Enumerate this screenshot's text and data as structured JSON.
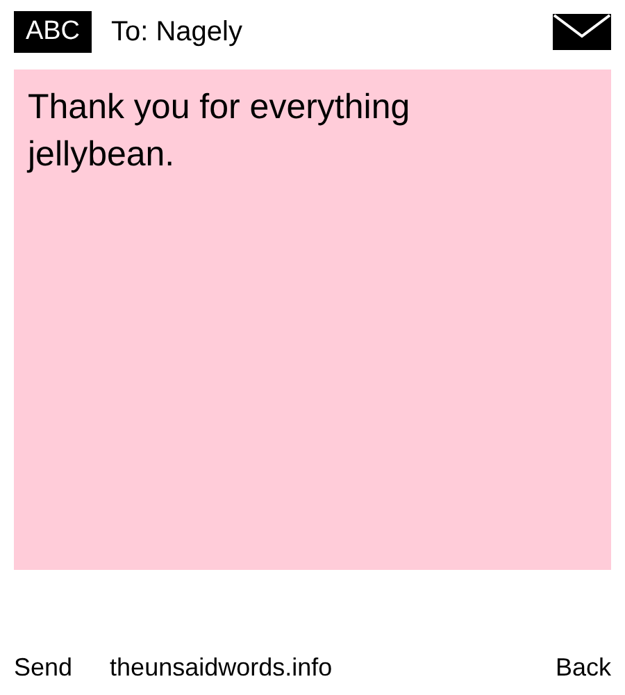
{
  "header": {
    "keyboard_mode": "ABC",
    "recipient": "To: Nagely"
  },
  "message": {
    "text": "Thank you for everything jellybean."
  },
  "footer": {
    "send": "Send",
    "site": "theunsaidwords.info",
    "back": "Back"
  }
}
